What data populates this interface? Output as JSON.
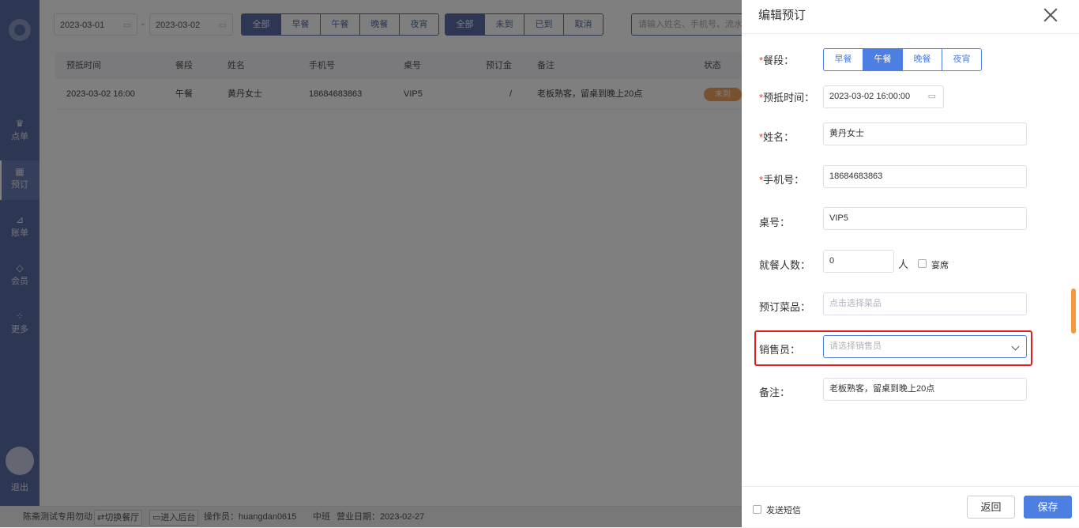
{
  "sidebar": {
    "items": [
      {
        "label": "点单",
        "icon": "crown-icon",
        "glyph": "♛"
      },
      {
        "label": "预订",
        "icon": "calendar-icon",
        "glyph": "▦"
      },
      {
        "label": "账单",
        "icon": "chart-icon",
        "glyph": "⊿"
      },
      {
        "label": "会员",
        "icon": "diamond-icon",
        "glyph": "◇"
      },
      {
        "label": "更多",
        "icon": "grid-icon",
        "glyph": "⁘"
      }
    ],
    "logout": "退出"
  },
  "filters": {
    "date_start": "2023-03-01",
    "date_end": "2023-03-02",
    "separator": "-",
    "meal_tabs": [
      "全部",
      "早餐",
      "午餐",
      "晚餐",
      "夜宵"
    ],
    "meal_selected": "全部",
    "status_tabs": [
      "全部",
      "未到",
      "已到",
      "取消"
    ],
    "status_selected": "全部",
    "search_placeholder": "请输入姓名、手机号、流水号、"
  },
  "table": {
    "headers": [
      "预抵时间",
      "餐段",
      "姓名",
      "手机号",
      "桌号",
      "预订金",
      "备注",
      "状态"
    ],
    "rows": [
      {
        "time": "2023-03-02 16:00",
        "meal": "午餐",
        "name": "黄丹女士",
        "phone": "18684683863",
        "table": "VIP5",
        "deposit": "/",
        "remark": "老板熟客，留桌到晚上20点",
        "status": "未到"
      }
    ]
  },
  "footer": {
    "store": "陈斋测试专用勿动",
    "switch": "⇄切换餐厅",
    "backend": "▭进入后台",
    "operator": "操作员：huangdan0615",
    "shift": "中班",
    "business_date": "营业日期：2023-02-27"
  },
  "drawer": {
    "title": "编辑预订",
    "meal": {
      "label": "餐段：",
      "options": [
        "早餐",
        "午餐",
        "晚餐",
        "夜宵"
      ],
      "selected": "午餐"
    },
    "arrival": {
      "label": "预抵时间：",
      "value": "2023-03-02 16:00:00"
    },
    "name": {
      "label": "姓名：",
      "value": "黄丹女士"
    },
    "phone": {
      "label": "手机号：",
      "value": "18684683863"
    },
    "table_no": {
      "label": "桌号：",
      "value": "VIP5"
    },
    "guests": {
      "label": "就餐人数：",
      "value": "0",
      "unit": "人",
      "banquet": "宴席"
    },
    "dishes": {
      "label": "预订菜品：",
      "placeholder": "点击选择菜品"
    },
    "salesperson": {
      "label": "销售员：",
      "placeholder": "请选择销售员"
    },
    "remark": {
      "label": "备注：",
      "value": "老板熟客，留桌到晚上20点"
    },
    "send_sms": "发送短信",
    "back_button": "返回",
    "save_button": "保存"
  },
  "colors": {
    "sidebar": "#5b6ea7",
    "accent": "#4d7fe3",
    "badge": "#f0a35e",
    "highlight": "#e02020"
  }
}
